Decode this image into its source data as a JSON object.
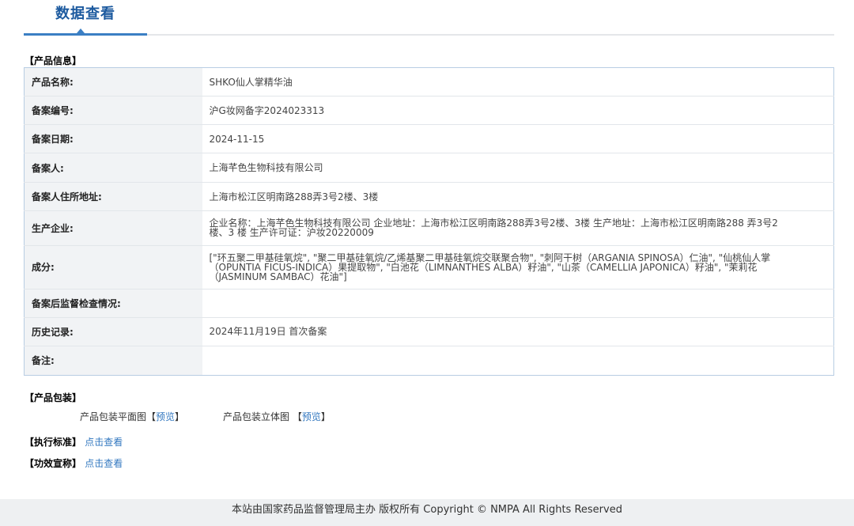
{
  "tab": {
    "title": "数据查看"
  },
  "product_info": {
    "heading": "【产品信息】",
    "rows": [
      {
        "label": "产品名称:",
        "value": "SHKO仙人掌精华油"
      },
      {
        "label": "备案编号:",
        "value": "沪G妆网备字2024023313"
      },
      {
        "label": "备案日期:",
        "value": "2024-11-15"
      },
      {
        "label": "备案人:",
        "value": "上海芊色生物科技有限公司"
      },
      {
        "label": "备案人住所地址:",
        "value": "上海市松江区明南路288弄3号2楼、3楼"
      },
      {
        "label": "生产企业:",
        "value": "企业名称：上海芊色生物科技有限公司 企业地址：上海市松江区明南路288弄3号2楼、3楼 生产地址：上海市松江区明南路288 弄3号2楼、3 楼 生产许可证：沪妆20220009"
      },
      {
        "label": "成分:",
        "value": "[\"环五聚二甲基硅氧烷\", \"聚二甲基硅氧烷/乙烯基聚二甲基硅氧烷交联聚合物\", \"刺阿干树（ARGANIA SPINOSA）仁油\", \"仙桃仙人掌（OPUNTIA FICUS-INDICA）果提取物\", \"白池花（LIMNANTHES ALBA）籽油\", \"山茶（CAMELLIA JAPONICA）籽油\", \"茉莉花（JASMINUM SAMBAC）花油\"]"
      },
      {
        "label": "备案后监督检查情况:",
        "value": ""
      },
      {
        "label": "历史记录:",
        "value": "2024年11月19日 首次备案"
      },
      {
        "label": "备注:",
        "value": ""
      }
    ]
  },
  "packaging": {
    "heading": "【产品包装】",
    "flat_label": "产品包装平面图",
    "stereo_label": "产品包装立体图",
    "bracket_open": "【",
    "bracket_close": "】",
    "preview_link": "预览"
  },
  "standard": {
    "heading": "【执行标准】",
    "link": "点击查看"
  },
  "efficacy": {
    "heading": "【功效宣称】",
    "link": "点击查看"
  },
  "footer": {
    "text": "本站由国家药品监督管理局主办 版权所有 Copyright © NMPA All Rights Reserved"
  }
}
